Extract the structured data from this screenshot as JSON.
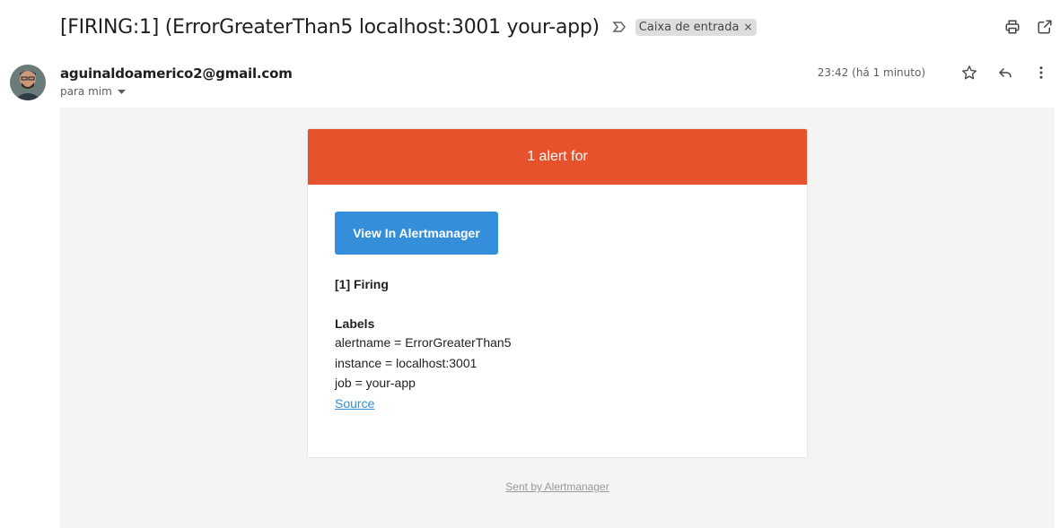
{
  "email": {
    "subject": "[FIRING:1] (ErrorGreaterThan5 localhost:3001 your-app)",
    "label": "Caixa de entrada",
    "label_remove": "×",
    "sender": "aguinaldoamerico2@gmail.com",
    "recipient": "para mim",
    "time": "23:42 (há 1 minuto)"
  },
  "alert": {
    "header": "1 alert for",
    "button_label": "View In Alertmanager",
    "firing": "[1] Firing",
    "labels_title": "Labels",
    "labels": [
      "alertname = ErrorGreaterThan5",
      "instance = localhost:3001",
      "job = your-app"
    ],
    "source_label": "Source",
    "footer": "Sent by Alertmanager"
  },
  "colors": {
    "header_bg": "#e6522c",
    "button_bg": "#348eda",
    "body_bg": "#f4f4f4"
  },
  "icons": {
    "important": "important-marker-icon",
    "print": "print-icon",
    "open_new": "open-in-new-window-icon",
    "star": "star-icon",
    "reply": "reply-icon",
    "more": "more-vert-icon",
    "dropdown": "caret-down-icon"
  }
}
